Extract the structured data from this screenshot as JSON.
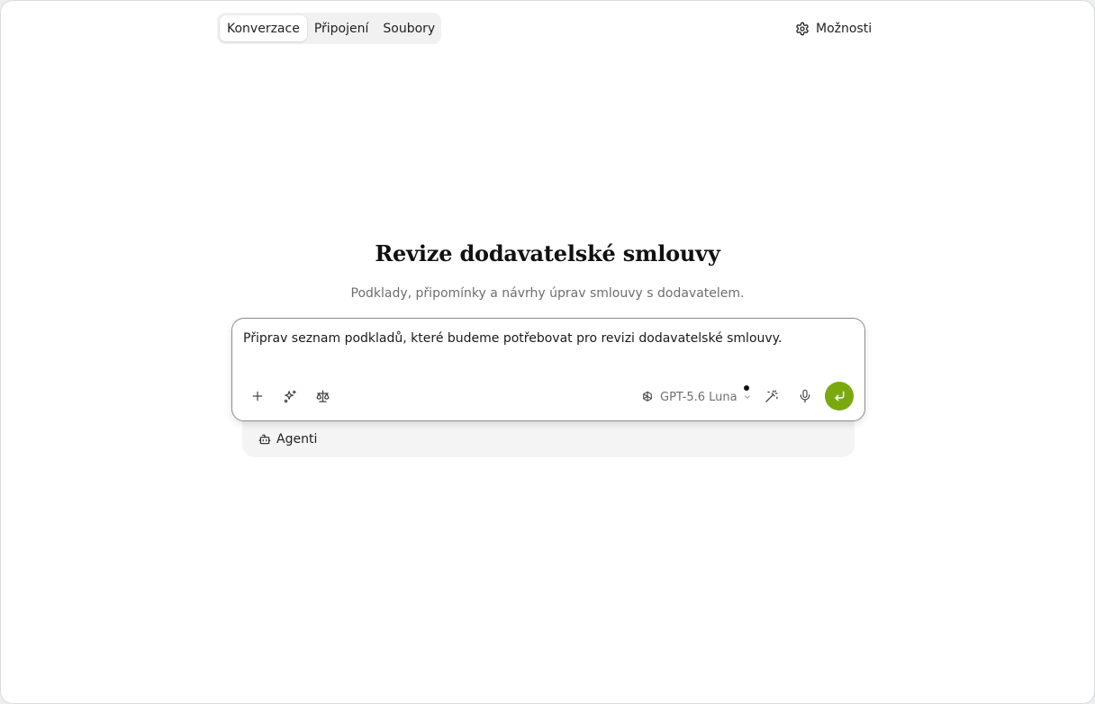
{
  "tabs": [
    {
      "label": "Konverzace",
      "active": true
    },
    {
      "label": "Připojení",
      "active": false
    },
    {
      "label": "Soubory",
      "active": false
    }
  ],
  "options": {
    "label": "Možnosti",
    "icon": "gear-icon"
  },
  "hero": {
    "title": "Revize dodavatelské smlouvy",
    "subtitle": "Podklady, připomínky a návrhy úprav smlouvy s dodavatelem."
  },
  "composer": {
    "prompt": "Připrav seznam podkladů, které budeme potřebovat pro revizi dodavatelské smlouvy.",
    "left_tools": [
      "plus-icon",
      "sparkles-icon",
      "scale-icon"
    ],
    "model": {
      "label": "GPT-5.6 Luna",
      "icon": "openai-icon"
    },
    "right_tools": [
      "magic-wand-icon",
      "microphone-icon"
    ],
    "send_icon": "enter-arrow-icon"
  },
  "agents": {
    "label": "Agenti",
    "icon": "robot-icon"
  },
  "colors": {
    "accent": "#7aa90f",
    "background": "#ffffff",
    "muted_text": "#6e6e6e",
    "tab_bar": "#f1f1f1"
  }
}
